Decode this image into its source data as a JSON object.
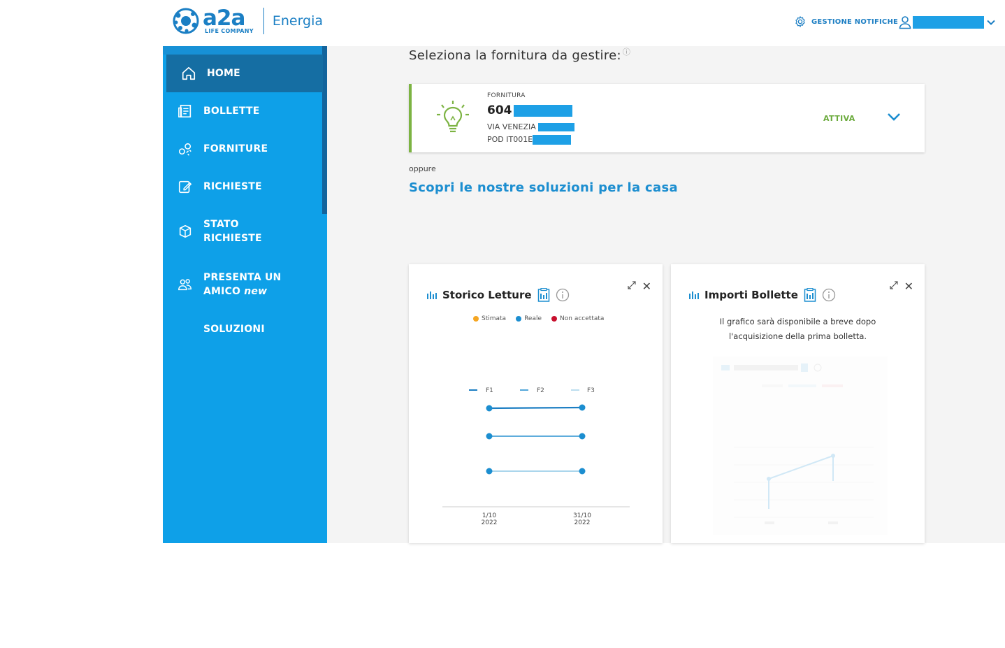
{
  "header": {
    "logo_brand": "a2a",
    "logo_tagline": "LIFE COMPANY",
    "logo_product": "Energia",
    "notifications_label": "GESTIONE NOTIFICHE"
  },
  "sidebar": {
    "items": [
      {
        "label": "HOME",
        "icon": "home-icon",
        "active": true
      },
      {
        "label": "BOLLETTE",
        "icon": "bill-icon"
      },
      {
        "label": "FORNITURE",
        "icon": "supply-icon"
      },
      {
        "label": "RICHIESTE",
        "icon": "request-icon"
      },
      {
        "label_line1": "STATO",
        "label_line2": "RICHIESTE",
        "icon": "status-icon"
      },
      {
        "label_line1": "PRESENTA UN",
        "label_line2": "AMICO",
        "badge": "new",
        "icon": "friends-icon"
      },
      {
        "label": "SOLUZIONI"
      }
    ]
  },
  "main": {
    "select_title": "Seleziona la fornitura da gestire:",
    "supply": {
      "label": "FORNITURA",
      "number": "604",
      "address": "VIA VENEZIA",
      "pod": "POD IT001E",
      "status": "ATTIVA"
    },
    "oppure": "oppure",
    "discover_link": "Scopri le nostre soluzioni per la casa"
  },
  "widgets": {
    "letture": {
      "title": "Storico Letture",
      "legend": [
        {
          "label": "Stimata",
          "color": "#f5a623"
        },
        {
          "label": "Reale",
          "color": "#1c8ed0"
        },
        {
          "label": "Non accettata",
          "color": "#c8102e"
        }
      ]
    },
    "bollette": {
      "title": "Importi Bollette",
      "message_line1": "Il grafico sarà disponibile a breve dopo",
      "message_line2": "l'acquisizione della prima bolletta."
    }
  },
  "chart_data": {
    "type": "line",
    "categories": [
      "1/10 2022",
      "31/10 2022"
    ],
    "series": [
      {
        "name": "F1"
      },
      {
        "name": "F2"
      },
      {
        "name": "F3"
      }
    ],
    "x_tick_labels": [
      [
        "1/10",
        "2022"
      ],
      [
        "31/10",
        "2022"
      ]
    ]
  },
  "colors": {
    "sidebar_bg": "#0ea0e8",
    "sidebar_active": "#156ea3",
    "brand_blue": "#1b7fc4",
    "status_green": "#6aaa3b"
  }
}
